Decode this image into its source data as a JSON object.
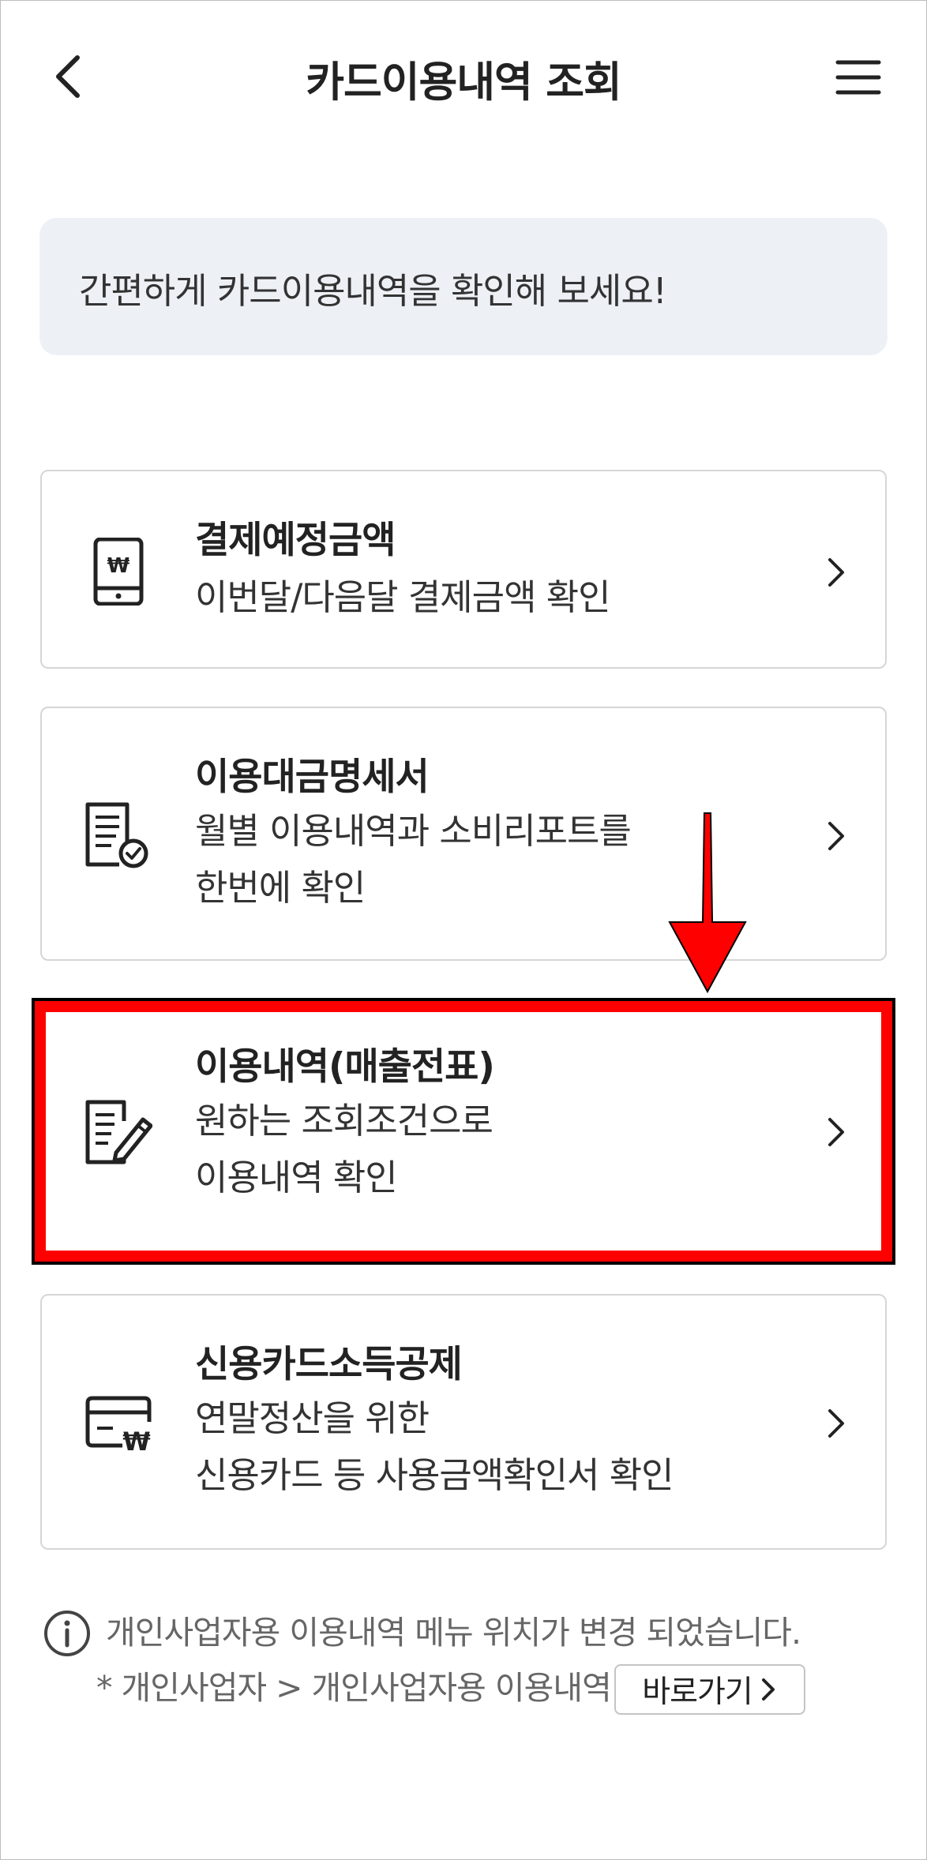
{
  "header": {
    "title": "카드이용내역 조회",
    "back_icon": "chevron-left-icon",
    "menu_icon": "hamburger-menu-icon"
  },
  "banner": {
    "text": "간편하게 카드이용내역을 확인해 보세요!"
  },
  "menu_items": [
    {
      "title": "결제예정금액",
      "desc_lines": [
        "이번달/다음달 결제금액 확인"
      ],
      "icon": "phone-won-icon"
    },
    {
      "title": "이용대금명세서",
      "desc_lines": [
        "월별 이용내역과 소비리포트를",
        "한번에 확인"
      ],
      "icon": "document-check-icon"
    },
    {
      "title": "이용내역(매출전표)",
      "desc_lines": [
        "원하는 조회조건으로",
        "이용내역 확인"
      ],
      "icon": "document-pen-icon",
      "highlighted": true
    },
    {
      "title": "신용카드소득공제",
      "desc_lines": [
        "연말정산을 위한",
        "신용카드 등 사용금액확인서 확인"
      ],
      "icon": "card-won-icon"
    }
  ],
  "footer": {
    "notice": "개인사업자용 이용내역 메뉴 위치가 변경 되었습니다.",
    "path": "* 개인사업자 > 개인사업자용 이용내역",
    "shortcut_label": "바로가기",
    "info_icon": "info-circle-icon"
  },
  "colors": {
    "banner_bg": "#edf1f6",
    "highlight": "#ff0000",
    "border": "#d6d6d6",
    "text": "#222222",
    "muted": "#666666"
  }
}
